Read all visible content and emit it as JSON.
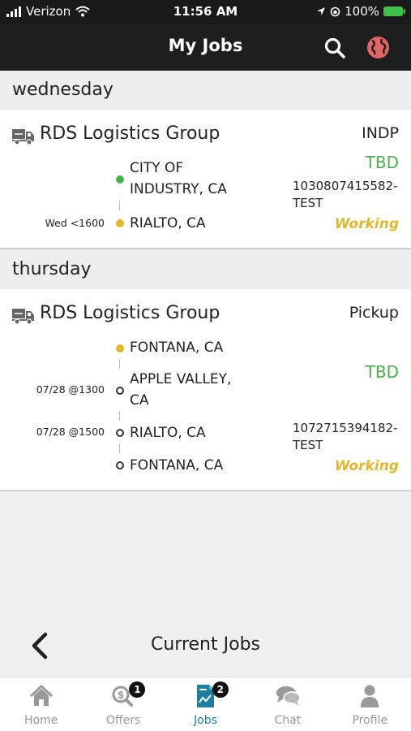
{
  "statusbar": {
    "carrier": "Verizon",
    "time": "11:56 AM",
    "battery": "100%"
  },
  "header": {
    "title": "My Jobs"
  },
  "days": [
    {
      "label": "wednesday",
      "job": {
        "company": "RDS Logistics Group",
        "type": "INDP",
        "tbd": "TBD",
        "id_line1": "1030807415582-",
        "id_line2": "TEST",
        "status": "Working",
        "stops": [
          {
            "city_line1": "CITY OF",
            "city_line2": "INDUSTRY, CA",
            "time": "",
            "dot": "green"
          },
          {
            "city_line1": "RIALTO, CA",
            "time": "Wed <1600",
            "dot": "yellow"
          }
        ]
      }
    },
    {
      "label": "thursday",
      "job": {
        "company": "RDS Logistics Group",
        "type": "Pickup",
        "tbd": "TBD",
        "id_line1": "1072715394182-",
        "id_line2": "TEST",
        "status": "Working",
        "stops": [
          {
            "city_line1": "FONTANA, CA",
            "time": "",
            "dot": "yellow"
          },
          {
            "city_line1": "APPLE VALLEY,",
            "city_line2": "CA",
            "time": "07/28 @1300",
            "dot": "hollow"
          },
          {
            "city_line1": "RIALTO, CA",
            "time": "07/28 @1500",
            "dot": "hollow"
          },
          {
            "city_line1": "FONTANA, CA",
            "time": "",
            "dot": "hollow"
          }
        ]
      }
    }
  ],
  "bottombar": {
    "title": "Current Jobs"
  },
  "tabs": [
    {
      "label": "Home",
      "icon": "home-icon",
      "badge": ""
    },
    {
      "label": "Offers",
      "icon": "offers-icon",
      "badge": "1"
    },
    {
      "label": "Jobs",
      "icon": "jobs-icon",
      "badge": "2",
      "active": true
    },
    {
      "label": "Chat",
      "icon": "chat-icon",
      "badge": ""
    },
    {
      "label": "Profile",
      "icon": "profile-icon",
      "badge": ""
    }
  ],
  "colors": {
    "accent": "#1a7fa0",
    "tbd": "#4caf50",
    "working": "#e0b82e",
    "header": "#1e1e1e"
  }
}
